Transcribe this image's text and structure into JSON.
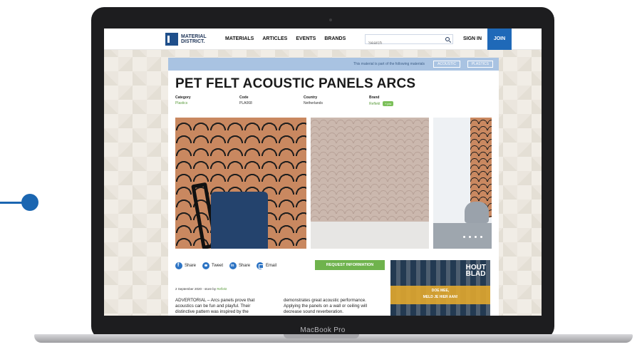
{
  "laptop": {
    "model_label": "MacBook Pro"
  },
  "site": {
    "logo_line1": "MATERIAL",
    "logo_line2": "DISTRICT.",
    "nav": [
      "MATERIALS",
      "ARTICLES",
      "EVENTS",
      "BRANDS"
    ],
    "search_placeholder": "Search",
    "signin": "SIGN IN",
    "join": "JOIN"
  },
  "banner": {
    "text": "This material is part of the following materials",
    "tags": [
      "ACOUSTIC",
      "PLASTICS"
    ]
  },
  "product": {
    "title": "PET FELT ACOUSTIC PANELS ARCS",
    "meta": [
      {
        "label": "Category",
        "value": "Plastics"
      },
      {
        "label": "Code",
        "value": "PLA068"
      },
      {
        "label": "Country",
        "value": "Netherlands"
      },
      {
        "label": "Brand",
        "value": "Reflekt",
        "badge": "+ pro"
      }
    ]
  },
  "share": {
    "items": [
      {
        "label": "Share",
        "icon": "facebook-icon"
      },
      {
        "label": "Tweet",
        "icon": "twitter-icon"
      },
      {
        "label": "Share",
        "icon": "linkedin-icon"
      },
      {
        "label": "Email",
        "icon": "email-icon"
      }
    ],
    "cta": "REQUEST INFORMATION"
  },
  "article": {
    "date": "2 September 2020 - store by",
    "author": "Reflekt",
    "col1": "ADVERTORIAL – Arcs panels prove that acoustics can be fun and playful. Their distinctive pattern was inspired by the",
    "col2": "demonstrates great acoustic performance. Applying the panels on a wall or ceiling will decrease sound reverberation."
  },
  "ad": {
    "brand_line1": "HOUT",
    "brand_line2": "BLAD",
    "line1": "DOE MEE,",
    "line2": "MELD JE HIER AAN!"
  }
}
